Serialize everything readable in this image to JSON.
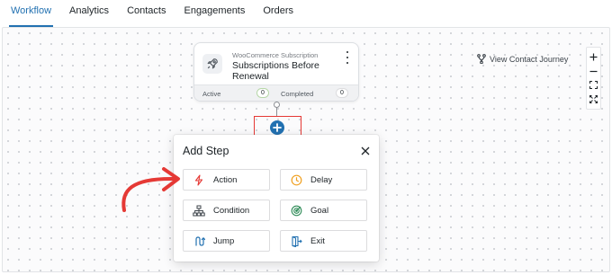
{
  "tabs": [
    {
      "label": "Workflow",
      "active": true
    },
    {
      "label": "Analytics",
      "active": false
    },
    {
      "label": "Contacts",
      "active": false
    },
    {
      "label": "Engagements",
      "active": false
    },
    {
      "label": "Orders",
      "active": false
    }
  ],
  "trigger": {
    "category": "WooCommerce Subscription",
    "title": "Subscriptions Before Renewal",
    "icon": "rocket-icon",
    "stats": {
      "active_label": "Active",
      "active_count": "0",
      "completed_label": "Completed",
      "completed_count": "0"
    }
  },
  "view_journey": {
    "label": "View Contact Journey",
    "icon": "fork-icon"
  },
  "zoom_controls": [
    "zoom-in-icon",
    "zoom-out-icon",
    "fit-view-icon",
    "fullscreen-icon"
  ],
  "add_step": {
    "title": "Add Step",
    "options": [
      {
        "label": "Action",
        "icon": "lightning-icon",
        "color": "#e53935"
      },
      {
        "label": "Delay",
        "icon": "clock-icon",
        "color": "#f0a020"
      },
      {
        "label": "Condition",
        "icon": "hierarchy-icon",
        "color": "#3c434a"
      },
      {
        "label": "Goal",
        "icon": "target-icon",
        "color": "#2e8b57"
      },
      {
        "label": "Jump",
        "icon": "jump-icon",
        "color": "#2271b1"
      },
      {
        "label": "Exit",
        "icon": "exit-icon",
        "color": "#2271b1"
      }
    ]
  },
  "colors": {
    "accent": "#2271b1",
    "highlight": "#e53935"
  }
}
